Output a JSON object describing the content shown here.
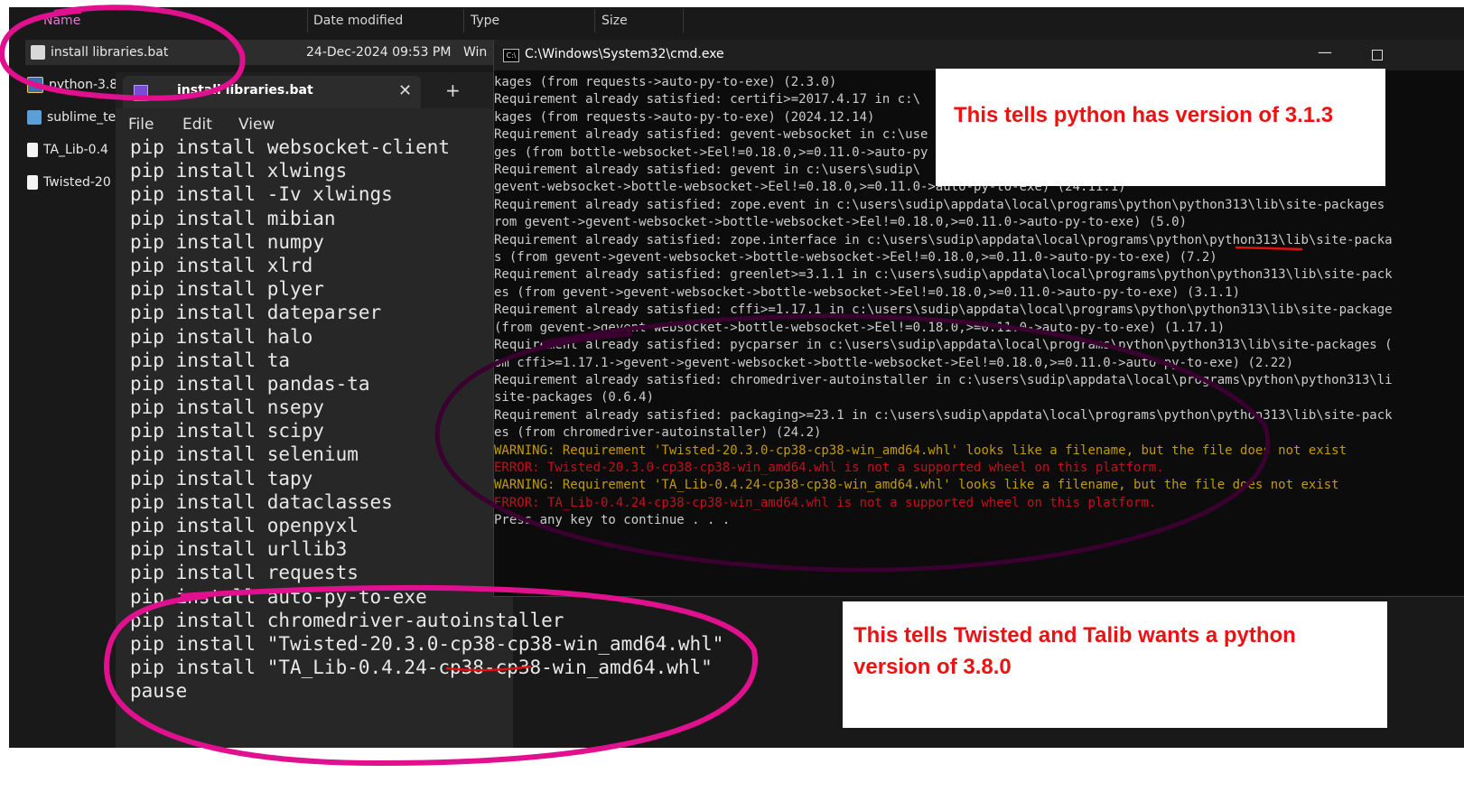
{
  "explorer": {
    "columns": [
      "Name",
      "Date modified",
      "Type",
      "Size"
    ],
    "files": [
      {
        "name": "install libraries.bat",
        "date": "24-Dec-2024 09:53 PM",
        "type": "Win",
        "icon": "bat-file-icon"
      },
      {
        "name": "python-3.8",
        "icon": "python-installer-icon"
      },
      {
        "name": "sublime_te",
        "icon": "sublime-icon"
      },
      {
        "name": "TA_Lib-0.4",
        "icon": "file-icon"
      },
      {
        "name": "Twisted-20",
        "icon": "file-icon"
      }
    ]
  },
  "notepad": {
    "tab_title": "install libraries.bat",
    "close_glyph": "✕",
    "new_tab_glyph": "+",
    "menu": [
      "File",
      "Edit",
      "View"
    ],
    "lines": [
      "pip install websocket-client",
      "pip install xlwings",
      "pip install -Iv xlwings",
      "pip install mibian",
      "pip install numpy",
      "pip install xlrd",
      "pip install plyer",
      "pip install dateparser",
      "pip install halo",
      "pip install ta",
      "pip install pandas-ta",
      "pip install nsepy",
      "pip install scipy",
      "pip install selenium",
      "pip install tapy",
      "pip install dataclasses",
      "pip install openpyxl",
      "pip install urllib3",
      "pip install requests",
      "pip install auto-py-to-exe",
      "pip install chromedriver-autoinstaller",
      "pip install \"Twisted-20.3.0-cp38-cp38-win_amd64.whl\"",
      "pip install \"TA_Lib-0.4.24-cp38-cp38-win_amd64.whl\"",
      "pause"
    ]
  },
  "cmd": {
    "title": "C:\\Windows\\System32\\cmd.exe",
    "minimize_glyph": "—",
    "lines": [
      {
        "text": "kages (from requests->auto-py-to-exe) (2.3.0)",
        "kind": "normal"
      },
      {
        "text": "Requirement already satisfied: certifi>=2017.4.17 in c:\\",
        "kind": "normal"
      },
      {
        "text": "kages (from requests->auto-py-to-exe) (2024.12.14)",
        "kind": "normal"
      },
      {
        "text": "Requirement already satisfied: gevent-websocket in c:\\use",
        "kind": "normal"
      },
      {
        "text": "ges (from bottle-websocket->Eel!=0.18.0,>=0.11.0->auto-py",
        "kind": "normal"
      },
      {
        "text": "Requirement already satisfied: gevent in c:\\users\\sudip\\",
        "kind": "normal"
      },
      {
        "text": "gevent-websocket->bottle-websocket->Eel!=0.18.0,>=0.11.0->auto-py-to-exe) (24.11.1)",
        "kind": "normal"
      },
      {
        "text": "Requirement already satisfied: zope.event in c:\\users\\sudip\\appdata\\local\\programs\\python\\python313\\lib\\site-packages",
        "kind": "normal"
      },
      {
        "text": "rom gevent->gevent-websocket->bottle-websocket->Eel!=0.18.0,>=0.11.0->auto-py-to-exe) (5.0)",
        "kind": "normal"
      },
      {
        "text": "Requirement already satisfied: zope.interface in c:\\users\\sudip\\appdata\\local\\programs\\python\\python313\\lib\\site-packa",
        "kind": "normal"
      },
      {
        "text": "s (from gevent->gevent-websocket->bottle-websocket->Eel!=0.18.0,>=0.11.0->auto-py-to-exe) (7.2)",
        "kind": "normal"
      },
      {
        "text": "Requirement already satisfied: greenlet>=3.1.1 in c:\\users\\sudip\\appdata\\local\\programs\\python\\python313\\lib\\site-pack",
        "kind": "normal"
      },
      {
        "text": "es (from gevent->gevent-websocket->bottle-websocket->Eel!=0.18.0,>=0.11.0->auto-py-to-exe) (3.1.1)",
        "kind": "normal"
      },
      {
        "text": "Requirement already satisfied: cffi>=1.17.1 in c:\\users\\sudip\\appdata\\local\\programs\\python\\python313\\lib\\site-package",
        "kind": "normal"
      },
      {
        "text": "(from gevent->gevent-websocket->bottle-websocket->Eel!=0.18.0,>=0.11.0->auto-py-to-exe) (1.17.1)",
        "kind": "normal"
      },
      {
        "text": "Requirement already satisfied: pycparser in c:\\users\\sudip\\appdata\\local\\programs\\python\\python313\\lib\\site-packages (",
        "kind": "normal"
      },
      {
        "text": "om cffi>=1.17.1->gevent->gevent-websocket->bottle-websocket->Eel!=0.18.0,>=0.11.0->auto-py-to-exe) (2.22)",
        "kind": "normal"
      },
      {
        "text": "Requirement already satisfied: chromedriver-autoinstaller in c:\\users\\sudip\\appdata\\local\\programs\\python\\python313\\li",
        "kind": "normal"
      },
      {
        "text": "site-packages (0.6.4)",
        "kind": "normal"
      },
      {
        "text": "Requirement already satisfied: packaging>=23.1 in c:\\users\\sudip\\appdata\\local\\programs\\python\\python313\\lib\\site-pack",
        "kind": "normal"
      },
      {
        "text": "es (from chromedriver-autoinstaller) (24.2)",
        "kind": "normal"
      },
      {
        "text": "WARNING: Requirement 'Twisted-20.3.0-cp38-cp38-win_amd64.whl' looks like a filename, but the file does not exist",
        "kind": "warn"
      },
      {
        "text": "ERROR: Twisted-20.3.0-cp38-cp38-win_amd64.whl is not a supported wheel on this platform.",
        "kind": "err"
      },
      {
        "text": "WARNING: Requirement 'TA_Lib-0.4.24-cp38-cp38-win_amd64.whl' looks like a filename, but the file does not exist",
        "kind": "warn"
      },
      {
        "text": "ERROR: TA_Lib-0.4.24-cp38-cp38-win_amd64.whl is not a supported wheel on this platform.",
        "kind": "err"
      },
      {
        "text": "Press any key to continue . . .",
        "kind": "normal"
      }
    ]
  },
  "annotations": {
    "note1": "This tells python has version of 3.1.3",
    "note2": "This tells Twisted and Talib wants a  python version of 3.8.0"
  },
  "colors": {
    "scribble": "#e0108f",
    "underline": "#e01010",
    "note_text": "#ee1111"
  }
}
